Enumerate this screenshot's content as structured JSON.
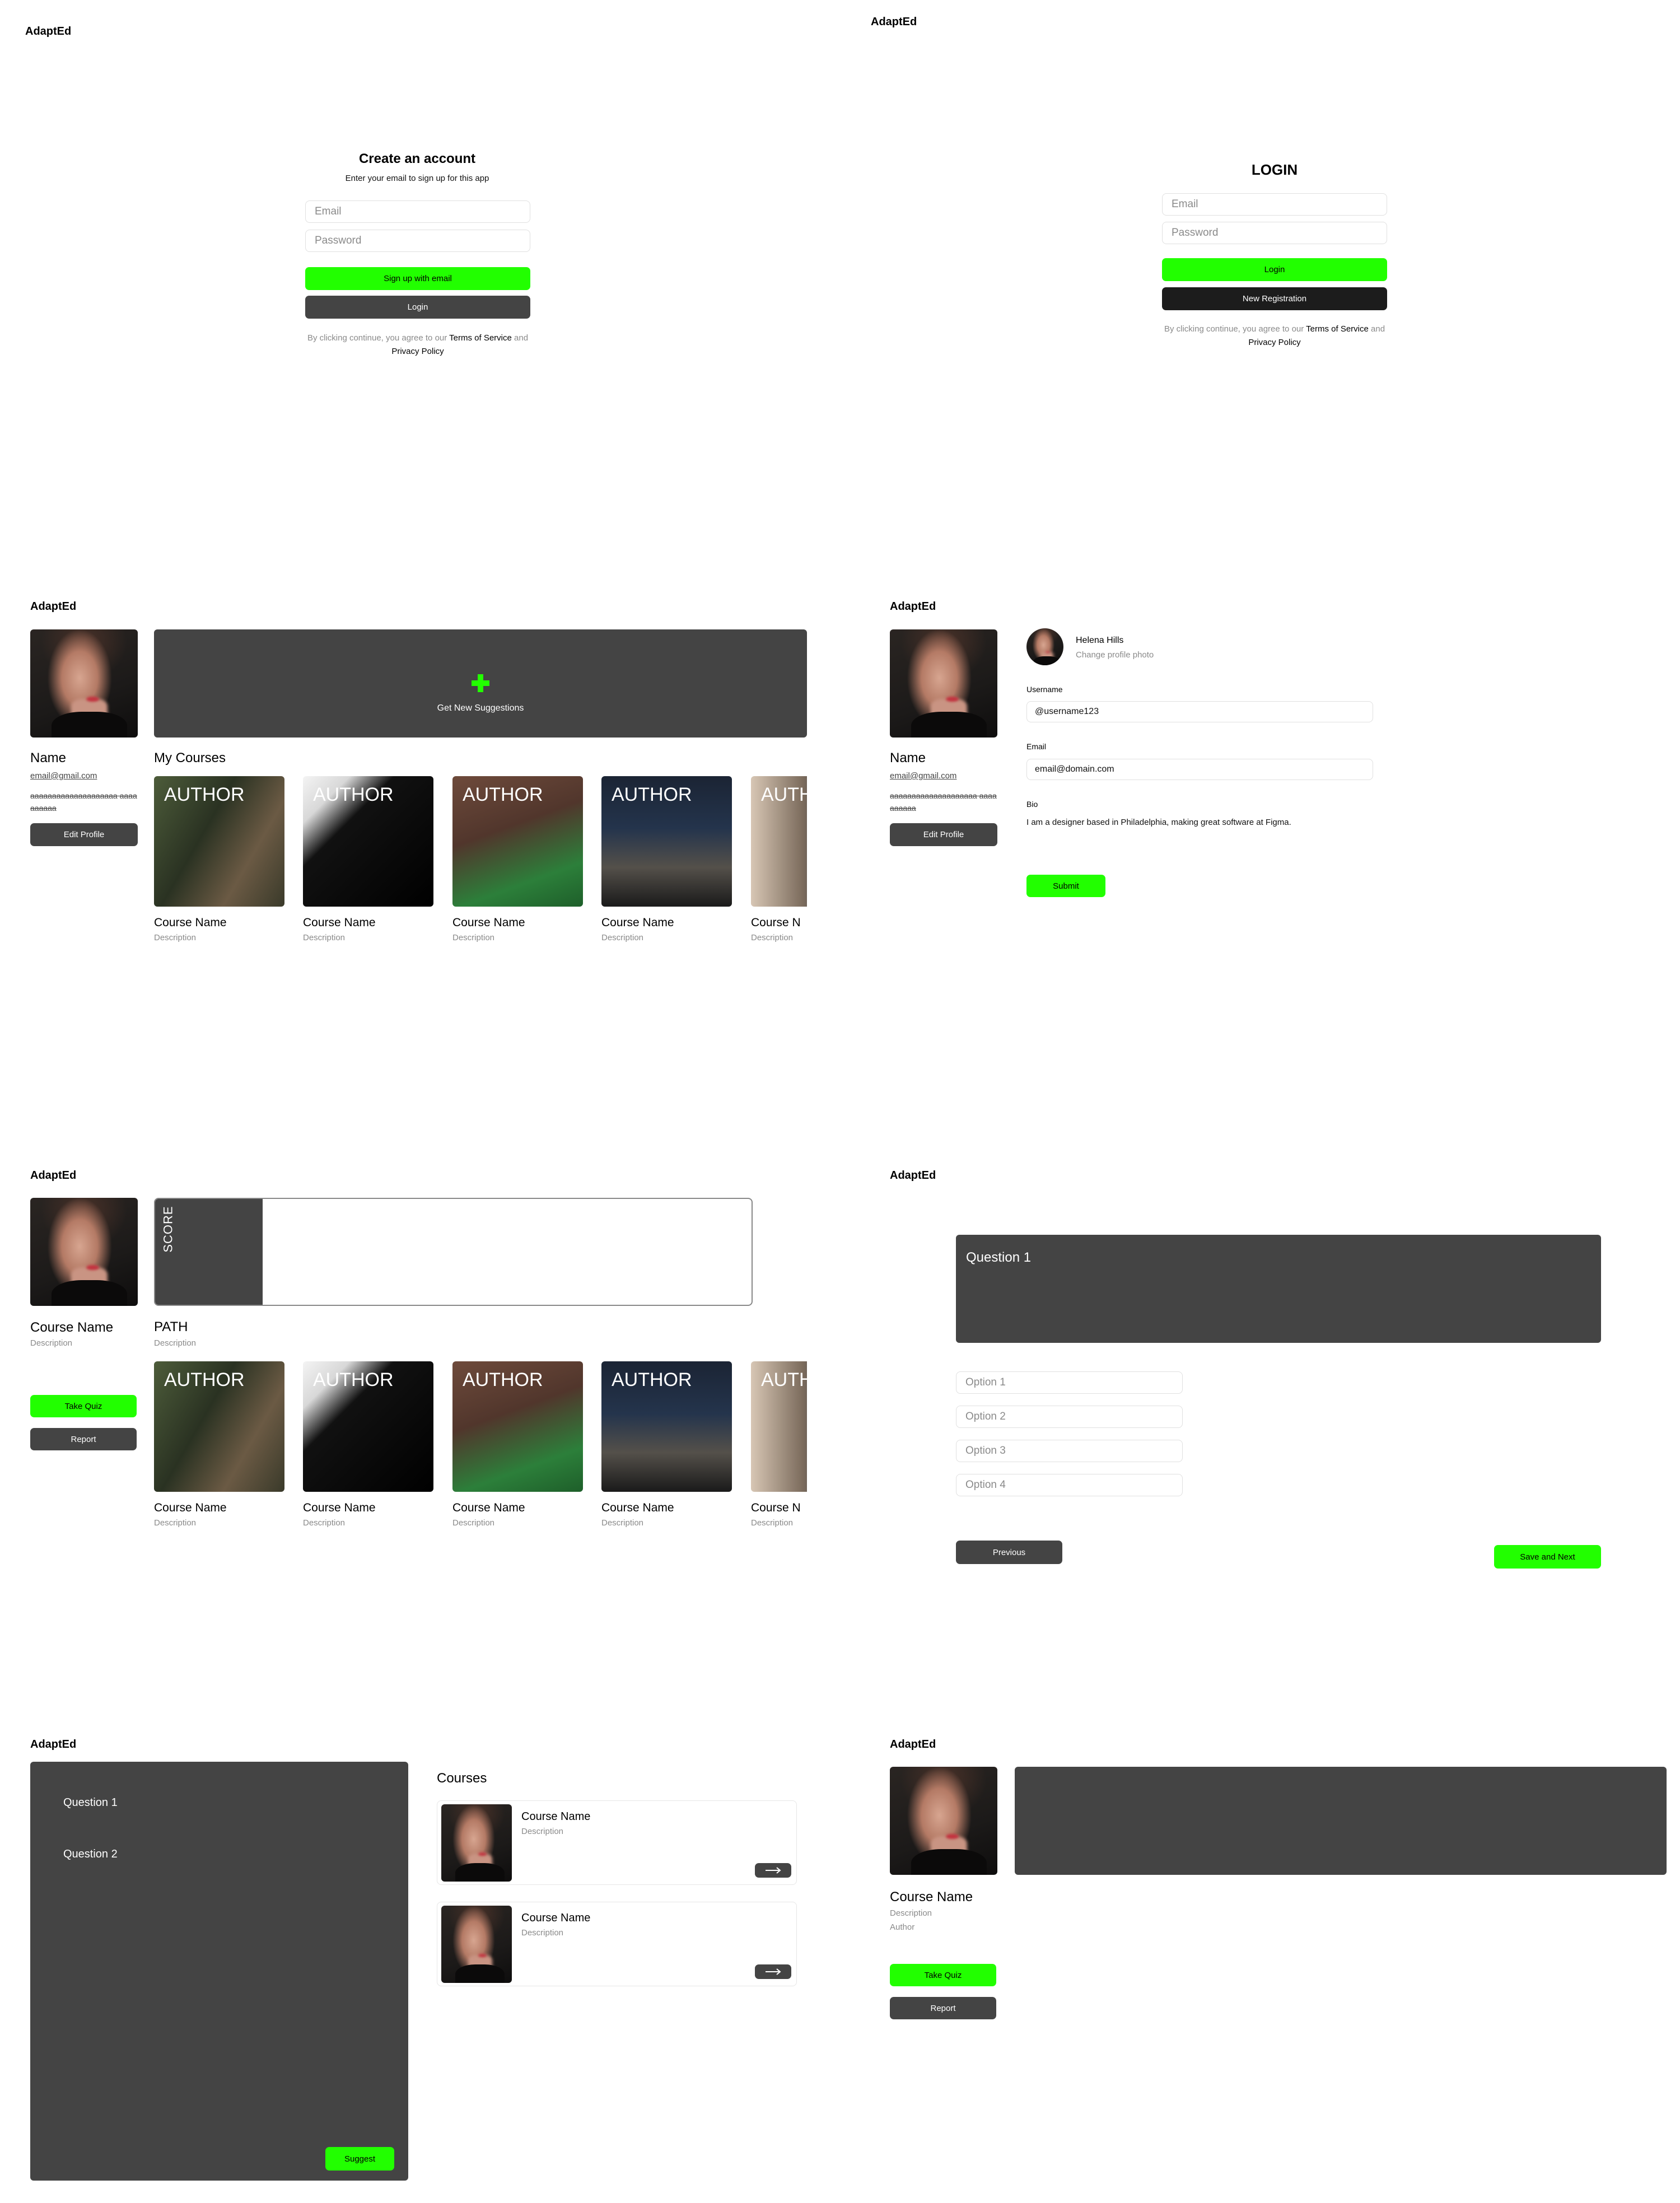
{
  "app_name": "AdaptEd",
  "signup": {
    "title": "Create an account",
    "subtitle": "Enter your email to sign up for this app",
    "email_placeholder": "Email",
    "password_placeholder": "Password",
    "signup_button": "Sign up with email",
    "login_button": "Login",
    "terms_prefix": "By clicking continue, you agree to our",
    "terms_link": "Terms of Service",
    "terms_and": "and",
    "privacy_link": "Privacy Policy"
  },
  "login": {
    "title": "LOGIN",
    "email_placeholder": "Email",
    "password_placeholder": "Password",
    "login_button": "Login",
    "register_button": "New Registration",
    "terms_prefix": "By clicking continue, you agree to our",
    "terms_link": "Terms of Service",
    "terms_and": "and",
    "privacy_link": "Privacy Policy"
  },
  "dashboard": {
    "name": "Name",
    "email": "email@gmail.com",
    "bio": "aaaaaaaaaaaaaaaaaaaa aaaaaaaaaa",
    "edit_profile": "Edit Profile",
    "suggest_label": "Get New Suggestions",
    "my_courses_title": "My Courses",
    "course_cards": [
      {
        "author": "AUTHOR",
        "name": "Course Name",
        "desc": "Description"
      },
      {
        "author": "AUTHOR",
        "name": "Course Name",
        "desc": "Description"
      },
      {
        "author": "AUTHOR",
        "name": "Course Name",
        "desc": "Description"
      },
      {
        "author": "AUTHOR",
        "name": "Course Name",
        "desc": "Description"
      },
      {
        "author": "AUTH",
        "name": "Course N",
        "desc": "Description"
      }
    ]
  },
  "edit_profile": {
    "name": "Name",
    "email": "email@gmail.com",
    "bio": "aaaaaaaaaaaaaaaaaaaa aaaaaaaaaa",
    "edit_profile": "Edit Profile",
    "user_full_name": "Helena Hills",
    "change_photo": "Change profile photo",
    "username_label": "Username",
    "username_value": "@username123",
    "email_label": "Email",
    "email_value": "email@domain.com",
    "bio_label": "Bio",
    "bio_value": "I am a designer based in Philadelphia, making great software at Figma.",
    "submit": "Submit"
  },
  "course_path": {
    "course_name": "Course Name",
    "description": "Description",
    "score_label": "SCORE",
    "score_fraction": 0.18,
    "path_title": "PATH",
    "path_desc": "Description",
    "take_quiz": "Take Quiz",
    "report": "Report",
    "course_cards": [
      {
        "author": "AUTHOR",
        "name": "Course Name",
        "desc": "Description"
      },
      {
        "author": "AUTHOR",
        "name": "Course Name",
        "desc": "Description"
      },
      {
        "author": "AUTHOR",
        "name": "Course Name",
        "desc": "Description"
      },
      {
        "author": "AUTHOR",
        "name": "Course Name",
        "desc": "Description"
      },
      {
        "author": "AUTH",
        "name": "Course N",
        "desc": "Description"
      }
    ]
  },
  "quiz": {
    "question": "Question 1",
    "options": [
      "Option 1",
      "Option 2",
      "Option 3",
      "Option 4"
    ],
    "previous": "Previous",
    "save_next": "Save and Next"
  },
  "suggest": {
    "questions": [
      "Question 1",
      "Question 2"
    ],
    "suggest_button": "Suggest",
    "courses_title": "Courses",
    "courses": [
      {
        "name": "Course Name",
        "desc": "Description"
      },
      {
        "name": "Course Name",
        "desc": "Description"
      }
    ]
  },
  "course_detail": {
    "course_name": "Course Name",
    "description": "Description",
    "author": "Author",
    "take_quiz": "Take Quiz",
    "report": "Report"
  },
  "colors": {
    "accent": "#22ff00",
    "dark": "#444444",
    "black": "#1c1c1c"
  }
}
